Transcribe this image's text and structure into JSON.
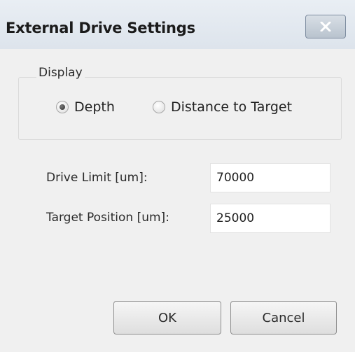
{
  "window": {
    "title": "External Drive Settings",
    "close_icon": "close-icon"
  },
  "display_group": {
    "title": "Display",
    "options": [
      {
        "label": "Depth",
        "selected": true
      },
      {
        "label": "Distance to Target",
        "selected": false
      }
    ]
  },
  "fields": {
    "drive_limit": {
      "label": "Drive Limit [um]:",
      "value": "70000"
    },
    "target_position": {
      "label": "Target Position [um]:",
      "value": "25000"
    }
  },
  "buttons": {
    "ok": "OK",
    "cancel": "Cancel"
  }
}
